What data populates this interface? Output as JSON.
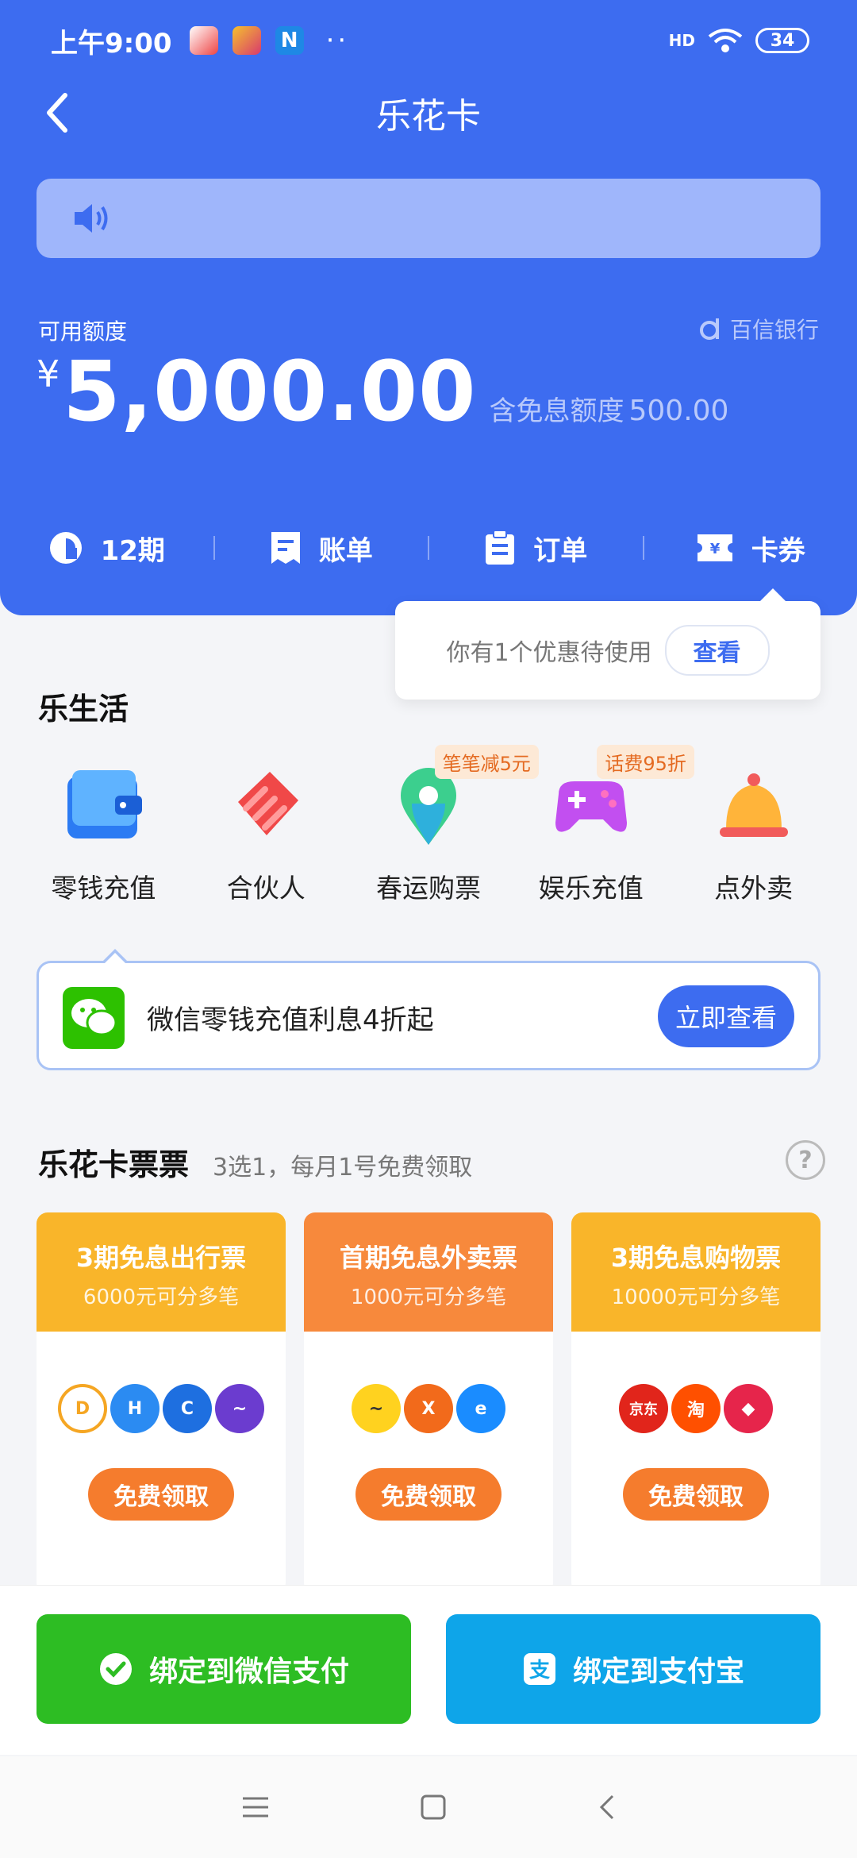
{
  "status_bar": {
    "time": "上午9:00",
    "dots": "··",
    "signal": "HD",
    "battery": "34"
  },
  "nav": {
    "title": "乐花卡"
  },
  "credit": {
    "label": "可用额度",
    "bank": "百信银行",
    "currency": "¥",
    "amount": "5,000.00",
    "free_label": "含免息额度",
    "free_amount": "500.00"
  },
  "tabs": [
    {
      "label": "12期",
      "icon": "pie-chart-icon"
    },
    {
      "label": "账单",
      "icon": "bill-icon"
    },
    {
      "label": "订单",
      "icon": "clipboard-icon"
    },
    {
      "label": "卡券",
      "icon": "coupon-icon"
    }
  ],
  "coupon_popover": {
    "text": "你有1个优惠待使用",
    "button": "查看"
  },
  "life": {
    "title": "乐生活",
    "items": [
      {
        "label": "零钱充值",
        "icon": "wallet-icon",
        "tag": ""
      },
      {
        "label": "合伙人",
        "icon": "partner-icon",
        "tag": ""
      },
      {
        "label": "春运购票",
        "icon": "location-pin-icon",
        "tag": "笔笔减5元"
      },
      {
        "label": "娱乐充值",
        "icon": "gamepad-icon",
        "tag": "话费95折"
      },
      {
        "label": "点外卖",
        "icon": "bell-icon",
        "tag": ""
      }
    ]
  },
  "wx_banner": {
    "text": "微信零钱充值利息4折起",
    "button": "立即查看"
  },
  "tickets": {
    "title": "乐花卡票票",
    "subtitle": "3选1，每月1号免费领取",
    "items": [
      {
        "title": "3期免息出行票",
        "sub": "6000元可分多笔",
        "claim": "免费领取",
        "color": "#f9b52a"
      },
      {
        "title": "首期免息外卖票",
        "sub": "1000元可分多笔",
        "claim": "免费领取",
        "color": "#f7893c"
      },
      {
        "title": "3期免息购物票",
        "sub": "10000元可分多笔",
        "claim": "免费领取",
        "color": "#f9b52a"
      }
    ],
    "brands_1": [
      "didi",
      "H",
      "C",
      "~"
    ],
    "brands_2": [
      "~",
      "X",
      "e"
    ],
    "brands_3": [
      "京东",
      "淘",
      "◆"
    ]
  },
  "bind": {
    "wechat": "绑定到微信支付",
    "alipay": "绑定到支付宝"
  },
  "colors": {
    "primary": "#3d6cf0",
    "wechat": "#2dbd23",
    "alipay": "#0ea5e9",
    "accent": "#f57c2d"
  }
}
